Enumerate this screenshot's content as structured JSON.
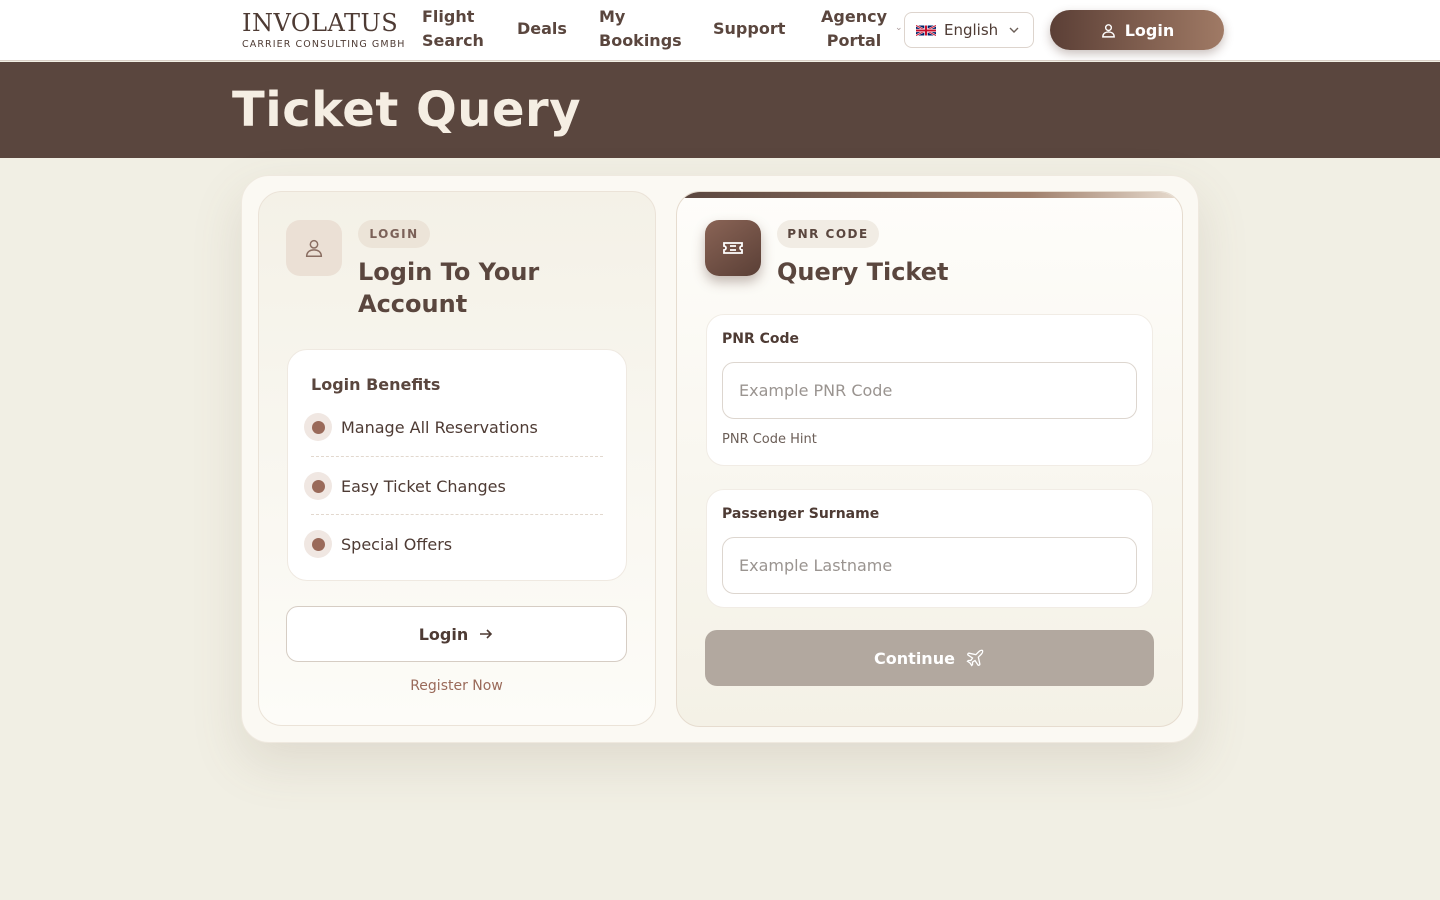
{
  "header": {
    "logo_main": "INVOLATUS",
    "logo_sub": "CARRIER CONSULTING GMBH",
    "nav": {
      "flight_search_line1": "Flight",
      "flight_search_line2": "Search",
      "deals": "Deals",
      "my_bookings_line1": "My",
      "my_bookings_line2": "Bookings",
      "support": "Support",
      "agency_portal_line1": "Agency",
      "agency_portal_line2": "Portal"
    },
    "language": "English",
    "login_label": "Login"
  },
  "hero": {
    "title": "Ticket Query"
  },
  "login_panel": {
    "badge": "LOGIN",
    "title": "Login To Your Account",
    "benefits_title": "Login Benefits",
    "benefits": [
      "Manage All Reservations",
      "Easy Ticket Changes",
      "Special Offers"
    ],
    "login_button": "Login",
    "register_link": "Register Now"
  },
  "query_panel": {
    "badge": "PNR CODE",
    "title": "Query Ticket",
    "pnr_label": "PNR Code",
    "pnr_placeholder": "Example PNR Code",
    "pnr_hint": "PNR Code Hint",
    "surname_label": "Passenger Surname",
    "surname_placeholder": "Example Lastname",
    "continue_button": "Continue"
  },
  "colors": {
    "brand_dark": "#5a463e",
    "brand_accent": "#9a6a5a",
    "page_bg": "#f1efe4",
    "disabled_button": "#b2a89f"
  },
  "icons": {
    "user": "user-icon",
    "ticket": "ticket-icon",
    "arrow": "arrow-right-icon",
    "plane": "plane-icon",
    "flag": "uk-flag-icon",
    "chevron": "chevron-down-icon"
  }
}
